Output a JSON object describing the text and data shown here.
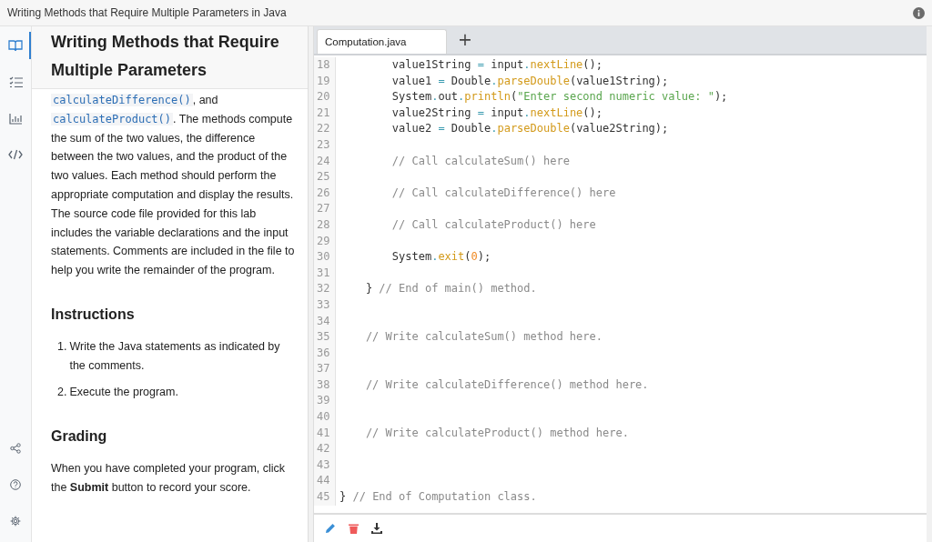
{
  "window": {
    "title": "Writing Methods that Require Multiple Parameters in Java"
  },
  "sidebar": {
    "items": [
      {
        "kind": "book",
        "selected": true
      },
      {
        "kind": "checklist",
        "selected": false
      },
      {
        "kind": "chart",
        "selected": false
      },
      {
        "kind": "code",
        "selected": false
      }
    ],
    "bottom_items": [
      {
        "kind": "share"
      },
      {
        "kind": "help"
      },
      {
        "kind": "settings"
      }
    ]
  },
  "lesson": {
    "title": "Writing Methods that Require Multiple Parameters",
    "intro": [
      {
        "kind": "code",
        "text": "calculateDifference()"
      },
      {
        "kind": "text",
        "text": ", and "
      },
      {
        "kind": "code",
        "text": "calculateProduct()"
      },
      {
        "kind": "text",
        "text": ". The methods compute the sum of the two values, the difference between the two values, and the product of the two values. Each method should perform the appropriate computation and display the results. The source code file provided for this lab includes the variable declarations and the input statements. Comments are included in the file to help you write the remainder of the program."
      }
    ],
    "sections": [
      {
        "heading": "Instructions",
        "kind": "list",
        "items": [
          {
            "marker": "1.",
            "text": "Write the Java statements as indicated by the comments."
          },
          {
            "marker": "2.",
            "text": "Execute the program."
          }
        ]
      },
      {
        "heading": "Grading",
        "kind": "paragraph",
        "text": "When you have completed your program, click the **Submit** button to record your score."
      }
    ]
  },
  "editor": {
    "tabs": [
      {
        "label": "Computation.java",
        "selected": true
      }
    ],
    "add_tab": "+",
    "lines": [
      {
        "num": "18",
        "tokens": [
          {
            "kind": "plain",
            "text": "        value1String"
          },
          {
            "kind": "op",
            "text": " = "
          },
          {
            "kind": "plain",
            "text": "input"
          },
          {
            "kind": "op",
            "text": "."
          },
          {
            "kind": "method",
            "text": "nextLine"
          },
          {
            "kind": "plain",
            "text": "();"
          }
        ]
      },
      {
        "num": "19",
        "tokens": [
          {
            "kind": "plain",
            "text": "        value1"
          },
          {
            "kind": "op",
            "text": " = "
          },
          {
            "kind": "plain",
            "text": "Double"
          },
          {
            "kind": "op",
            "text": "."
          },
          {
            "kind": "method",
            "text": "parseDouble"
          },
          {
            "kind": "plain",
            "text": "(value1String);"
          }
        ]
      },
      {
        "num": "20",
        "tokens": [
          {
            "kind": "plain",
            "text": "        System"
          },
          {
            "kind": "op",
            "text": "."
          },
          {
            "kind": "plain",
            "text": "out"
          },
          {
            "kind": "op",
            "text": "."
          },
          {
            "kind": "method",
            "text": "println"
          },
          {
            "kind": "plain",
            "text": "("
          },
          {
            "kind": "string",
            "text": "\"Enter second numeric value: \""
          },
          {
            "kind": "plain",
            "text": ");"
          }
        ]
      },
      {
        "num": "21",
        "tokens": [
          {
            "kind": "plain",
            "text": "        value2String"
          },
          {
            "kind": "op",
            "text": " = "
          },
          {
            "kind": "plain",
            "text": "input"
          },
          {
            "kind": "op",
            "text": "."
          },
          {
            "kind": "method",
            "text": "nextLine"
          },
          {
            "kind": "plain",
            "text": "();"
          }
        ]
      },
      {
        "num": "22",
        "tokens": [
          {
            "kind": "plain",
            "text": "        value2"
          },
          {
            "kind": "op",
            "text": " = "
          },
          {
            "kind": "plain",
            "text": "Double"
          },
          {
            "kind": "op",
            "text": "."
          },
          {
            "kind": "method",
            "text": "parseDouble"
          },
          {
            "kind": "plain",
            "text": "(value2String);"
          }
        ]
      },
      {
        "num": "23"
      },
      {
        "num": "24",
        "tokens": [
          {
            "kind": "comment",
            "text": "        // Call calculateSum() here"
          }
        ]
      },
      {
        "num": "25"
      },
      {
        "num": "26",
        "tokens": [
          {
            "kind": "comment",
            "text": "        // Call calculateDifference() here"
          }
        ]
      },
      {
        "num": "27"
      },
      {
        "num": "28",
        "tokens": [
          {
            "kind": "comment",
            "text": "        // Call calculateProduct() here"
          }
        ]
      },
      {
        "num": "29"
      },
      {
        "num": "30",
        "tokens": [
          {
            "kind": "plain",
            "text": "        System"
          },
          {
            "kind": "op",
            "text": "."
          },
          {
            "kind": "method",
            "text": "exit"
          },
          {
            "kind": "plain",
            "text": "("
          },
          {
            "kind": "number",
            "text": "0"
          },
          {
            "kind": "plain",
            "text": ");"
          }
        ]
      },
      {
        "num": "31"
      },
      {
        "num": "32",
        "tokens": [
          {
            "kind": "plain",
            "text": "    } "
          },
          {
            "kind": "comment",
            "text": "// End of main() method."
          }
        ]
      },
      {
        "num": "33"
      },
      {
        "num": "34"
      },
      {
        "num": "35",
        "tokens": [
          {
            "kind": "comment",
            "text": "    // Write calculateSum() method here."
          }
        ]
      },
      {
        "num": "36"
      },
      {
        "num": "37"
      },
      {
        "num": "38",
        "tokens": [
          {
            "kind": "comment",
            "text": "    // Write calculateDifference() method here."
          }
        ]
      },
      {
        "num": "39"
      },
      {
        "num": "40"
      },
      {
        "num": "41",
        "tokens": [
          {
            "kind": "comment",
            "text": "    // Write calculateProduct() method here."
          }
        ]
      },
      {
        "num": "42"
      },
      {
        "num": "43"
      },
      {
        "num": "44"
      },
      {
        "num": "45",
        "tokens": [
          {
            "kind": "plain",
            "text": "} "
          },
          {
            "kind": "comment",
            "text": "// End of Computation class."
          }
        ]
      }
    ],
    "actions": [
      {
        "kind": "edit"
      },
      {
        "kind": "delete"
      },
      {
        "kind": "download"
      }
    ]
  }
}
